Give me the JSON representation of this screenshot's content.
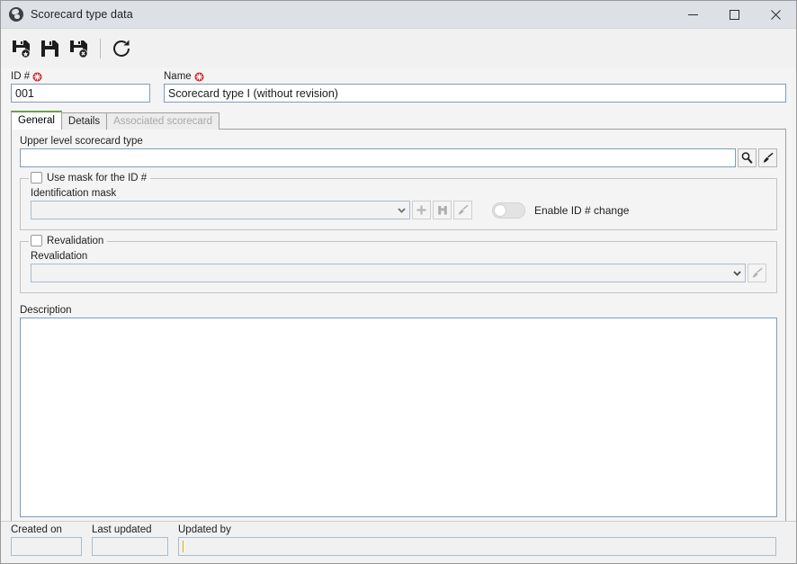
{
  "window": {
    "title": "Scorecard type data",
    "icon": "globe-icon",
    "controls": {
      "minimize": "minimize-icon",
      "maximize": "maximize-icon",
      "close": "close-icon"
    }
  },
  "toolbar": {
    "buttons": [
      {
        "name": "save-and-new-button",
        "icon": "save-new-icon"
      },
      {
        "name": "save-button",
        "icon": "save-icon"
      },
      {
        "name": "save-and-close-button",
        "icon": "save-close-icon"
      },
      {
        "name": "refresh-button",
        "icon": "refresh-icon"
      }
    ]
  },
  "header": {
    "id_label": "ID #",
    "id_value": "001",
    "id_required": true,
    "name_label": "Name",
    "name_value": "Scorecard type I (without revision)",
    "name_required": true
  },
  "tabs": [
    {
      "label": "General",
      "state": "active"
    },
    {
      "label": "Details",
      "state": "normal"
    },
    {
      "label": "Associated scorecard",
      "state": "disabled"
    }
  ],
  "general": {
    "upper_level": {
      "label": "Upper level scorecard type",
      "value": "",
      "search_icon": "magnifier-icon",
      "clear_icon": "brush-icon"
    },
    "mask_group": {
      "legend": "Use mask for the ID #",
      "checked": false,
      "field_label": "Identification mask",
      "field_value": "",
      "dropdown_icon": "chevron-down-icon",
      "add_icon": "plus-icon",
      "find_icon": "binoculars-icon",
      "clear_icon": "brush-icon",
      "toggle_label": "Enable ID # change",
      "toggle_on": false
    },
    "revalidation_group": {
      "legend": "Revalidation",
      "checked": false,
      "field_label": "Revalidation",
      "field_value": "",
      "dropdown_icon": "chevron-down-icon",
      "clear_icon": "brush-icon"
    },
    "description": {
      "label": "Description",
      "value": ""
    }
  },
  "footer": {
    "created_on_label": "Created on",
    "created_on_value": "",
    "last_updated_label": "Last updated",
    "last_updated_value": "",
    "updated_by_label": "Updated by",
    "updated_by_value": ""
  },
  "colors": {
    "titlebar": "#dde1e6",
    "accent_tab": "#6f9e4d",
    "required": "#cc2229",
    "field_border": "#7f9db9"
  }
}
